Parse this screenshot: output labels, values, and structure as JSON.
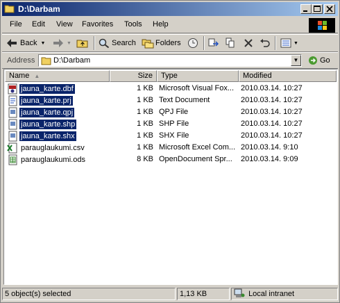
{
  "window": {
    "title": "D:\\Darbam"
  },
  "menu": [
    "File",
    "Edit",
    "View",
    "Favorites",
    "Tools",
    "Help"
  ],
  "toolbar": {
    "back_label": "Back",
    "search_label": "Search",
    "folders_label": "Folders"
  },
  "address": {
    "label": "Address",
    "value": "D:\\Darbam",
    "go_label": "Go"
  },
  "columns": {
    "name": "Name",
    "size": "Size",
    "type": "Type",
    "modified": "Modified"
  },
  "files": [
    {
      "name": "jauna_karte.dbf",
      "size": "1 KB",
      "type": "Microsoft Visual Fox...",
      "modified": "2010.03.14. 10:27",
      "icon": "dbf-file-icon",
      "selected": true
    },
    {
      "name": "jauna_karte.prj",
      "size": "1 KB",
      "type": "Text Document",
      "modified": "2010.03.14. 10:27",
      "icon": "text-file-icon",
      "selected": true
    },
    {
      "name": "jauna_karte.qpj",
      "size": "1 KB",
      "type": "QPJ File",
      "modified": "2010.03.14. 10:27",
      "icon": "generic-file-icon",
      "selected": true
    },
    {
      "name": "jauna_karte.shp",
      "size": "1 KB",
      "type": "SHP File",
      "modified": "2010.03.14. 10:27",
      "icon": "generic-file-icon",
      "selected": true
    },
    {
      "name": "jauna_karte.shx",
      "size": "1 KB",
      "type": "SHX File",
      "modified": "2010.03.14. 10:27",
      "icon": "generic-file-icon",
      "selected": true
    },
    {
      "name": "parauglaukumi.csv",
      "size": "1 KB",
      "type": "Microsoft Excel Com...",
      "modified": "2010.03.14. 9:10",
      "icon": "excel-file-icon",
      "selected": false
    },
    {
      "name": "parauglaukumi.ods",
      "size": "8 KB",
      "type": "OpenDocument Spr...",
      "modified": "2010.03.14. 9:09",
      "icon": "ods-file-icon",
      "selected": false
    }
  ],
  "status": {
    "selection": "5 object(s) selected",
    "size": "1,13 KB",
    "zone": "Local intranet"
  },
  "colors": {
    "titlebar_start": "#0a246a",
    "titlebar_end": "#a6caf0",
    "selection": "#0a246a",
    "chrome": "#d4d0c8"
  }
}
